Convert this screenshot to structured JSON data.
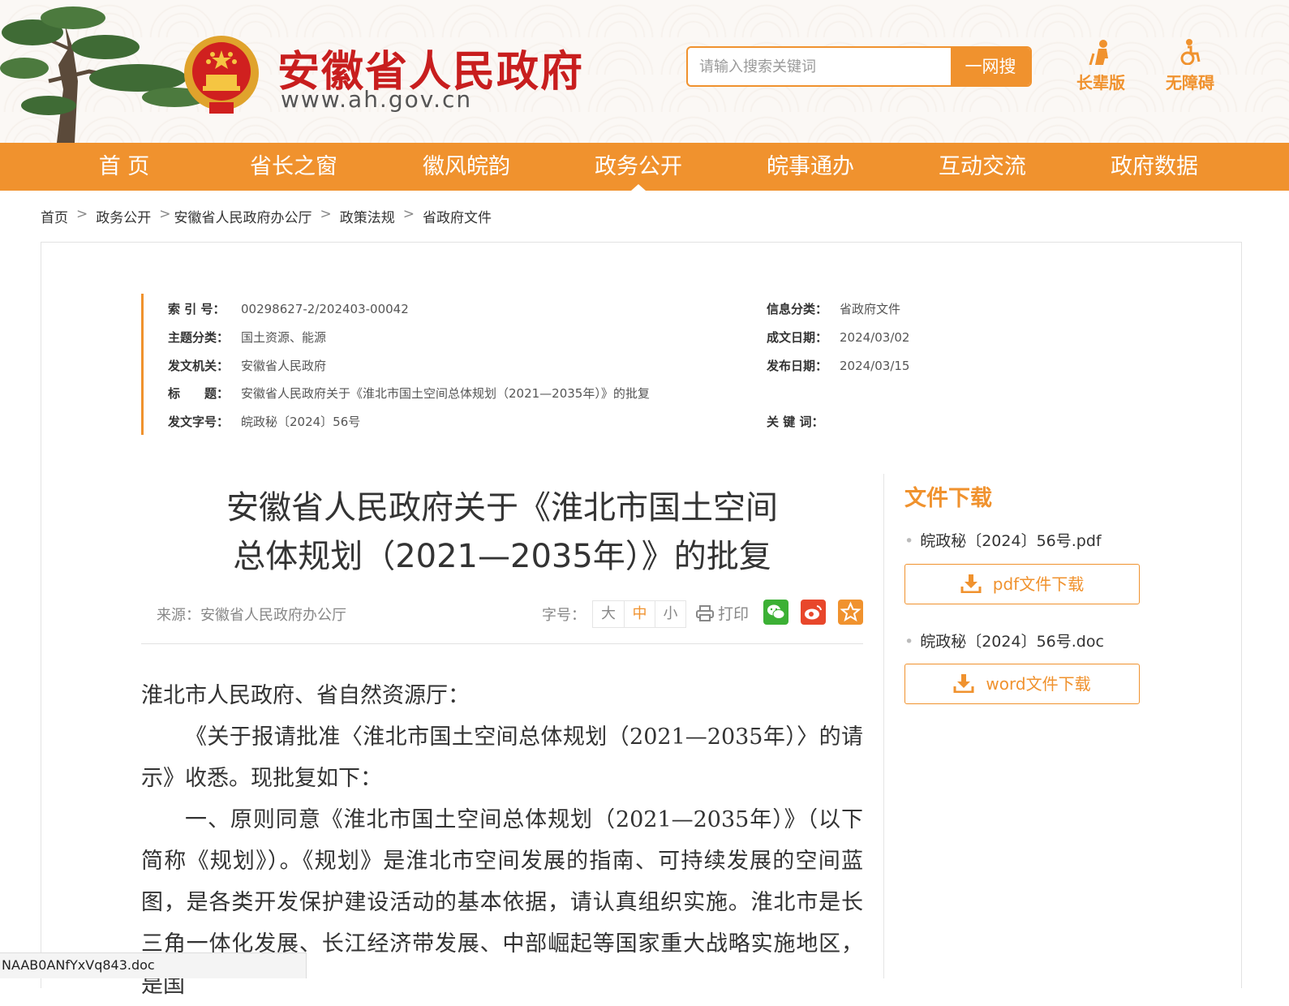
{
  "header": {
    "site_title": "安徽省人民政府",
    "site_url": "www.ah.gov.cn",
    "search": {
      "placeholder": "请输入搜索关键词",
      "button_label": "一网搜"
    },
    "tools": {
      "elder_label": "长辈版",
      "access_label": "无障碍"
    }
  },
  "nav": {
    "items": [
      "首 页",
      "省长之窗",
      "徽风皖韵",
      "政务公开",
      "皖事通办",
      "互动交流",
      "政府数据"
    ],
    "active": "政务公开"
  },
  "breadcrumb": [
    "首页",
    "政务公开",
    "安徽省人民政府办公厅",
    "政策法规",
    "省政府文件"
  ],
  "meta": {
    "index_no": {
      "label": "索 引 号：",
      "value": "00298627-2/202403-00042"
    },
    "topic": {
      "label": "主题分类：",
      "value": "国土资源、能源"
    },
    "issuer": {
      "label": "发文机关：",
      "value": "安徽省人民政府"
    },
    "title": {
      "label": "标　　题：",
      "value": "安徽省人民政府关于《淮北市国土空间总体规划（2021—2035年）》的批复"
    },
    "doc_no": {
      "label": "发文字号：",
      "value": "皖政秘〔2024〕56号"
    },
    "category": {
      "label": "信息分类：",
      "value": "省政府文件"
    },
    "written_date": {
      "label": "成文日期：",
      "value": "2024/03/02"
    },
    "publish_date": {
      "label": "发布日期：",
      "value": "2024/03/15"
    },
    "keywords": {
      "label": "关 键 词：",
      "value": ""
    }
  },
  "article": {
    "title_line1": "安徽省人民政府关于《淮北市国土空间",
    "title_line2": "总体规划（2021—2035年）》的批复",
    "source": "来源：安徽省人民政府办公厅",
    "font_size_label": "字号：",
    "font_sizes": [
      "大",
      "中",
      "小"
    ],
    "font_size_active": "中",
    "print_label": "打印",
    "paragraphs": [
      "淮北市人民政府、省自然资源厅：",
      "《关于报请批准〈淮北市国土空间总体规划（2021—2035年）〉的请示》收悉。现批复如下：",
      "一、原则同意《淮北市国土空间总体规划（2021—2035年）》（以下简称《规划》）。《规划》是淮北市空间发展的指南、可持续发展的空间蓝图，是各类开发保护建设活动的基本依据，请认真组织实施。淮北市是长三角一体化发展、长江经济带发展、中部崛起等国家重大战略实施地区，是国"
    ]
  },
  "downloads": {
    "title": "文件下载",
    "files": [
      {
        "name": "皖政秘〔2024〕56号.pdf",
        "button": "pdf文件下载"
      },
      {
        "name": "皖政秘〔2024〕56号.doc",
        "button": "word文件下载"
      }
    ]
  },
  "statusbar": {
    "text": "NAAB0ANfYxVq843.doc"
  },
  "colors": {
    "accent": "#f0922e",
    "title_red": "#c81e1e",
    "wechat": "#3cb035",
    "weibo": "#e8472b"
  }
}
